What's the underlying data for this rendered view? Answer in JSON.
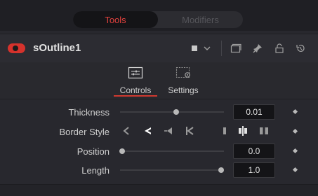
{
  "tabs": {
    "tools": "Tools",
    "modifiers": "Modifiers",
    "active": "tools"
  },
  "header": {
    "tool_name": "sOutline1",
    "enabled": true,
    "icons": [
      "color-square-icon",
      "chevron-down-icon",
      "window-icon",
      "pin-icon",
      "lock-icon",
      "reset-icon"
    ]
  },
  "inspector_tabs": {
    "controls": "Controls",
    "settings": "Settings",
    "active": "controls"
  },
  "params": {
    "thickness": {
      "label": "Thickness",
      "value": "0.01",
      "slider": 0.55
    },
    "border_style": {
      "label": "Border Style",
      "options": [
        "outline-left",
        "arrow-left",
        "left-arrow-inward",
        "bar-left-angled",
        "bar-thin",
        "bar-split-center",
        "bar-split"
      ],
      "selected": "arrow-left"
    },
    "position": {
      "label": "Position",
      "value": "0.0",
      "slider": 0.02
    },
    "length": {
      "label": "Length",
      "value": "1.0",
      "slider": 0.98
    }
  },
  "colors": {
    "accent": "#d5322c",
    "tab_active_text": "#e0413d",
    "background": "#28282e"
  }
}
